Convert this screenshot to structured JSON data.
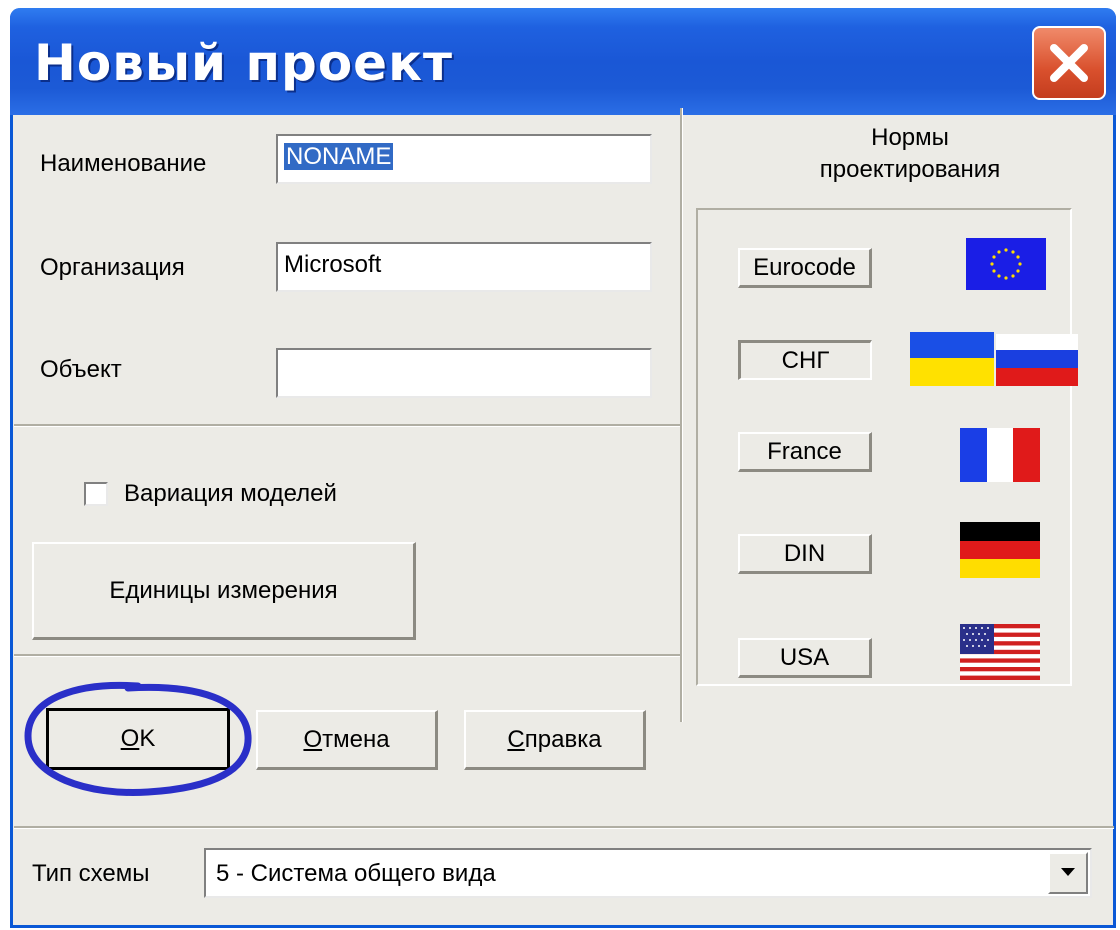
{
  "window": {
    "title": "Новый проект",
    "close_icon": "close-icon"
  },
  "fields": {
    "name_label": "Наименование",
    "name_value": "NONAME",
    "org_label": "Организация",
    "org_value": "Microsoft",
    "object_label": "Объект",
    "object_value": ""
  },
  "options": {
    "variation_label": "Вариация моделей",
    "variation_checked": false,
    "units_button": "Единицы измерения"
  },
  "actions": {
    "ok": "OK",
    "cancel": "Отмена",
    "help": "Справка"
  },
  "norms": {
    "title_line1": "Нормы",
    "title_line2": "проектирования",
    "items": [
      {
        "label": "Eurocode",
        "icon": "eu-flag-icon"
      },
      {
        "label": "СНГ",
        "icon": "ukraine-russia-flags-icon",
        "selected": true
      },
      {
        "label": "France",
        "icon": "france-flag-icon"
      },
      {
        "label": "DIN",
        "icon": "germany-flag-icon"
      },
      {
        "label": "USA",
        "icon": "usa-flag-icon"
      }
    ]
  },
  "scheme": {
    "label": "Тип схемы",
    "value": "5  - Система общего вида"
  },
  "colors": {
    "title_bar": "#1a57d6",
    "dialog_bg": "#ecebe6",
    "selection": "#316ac5",
    "annotation": "#2a2fc8"
  }
}
